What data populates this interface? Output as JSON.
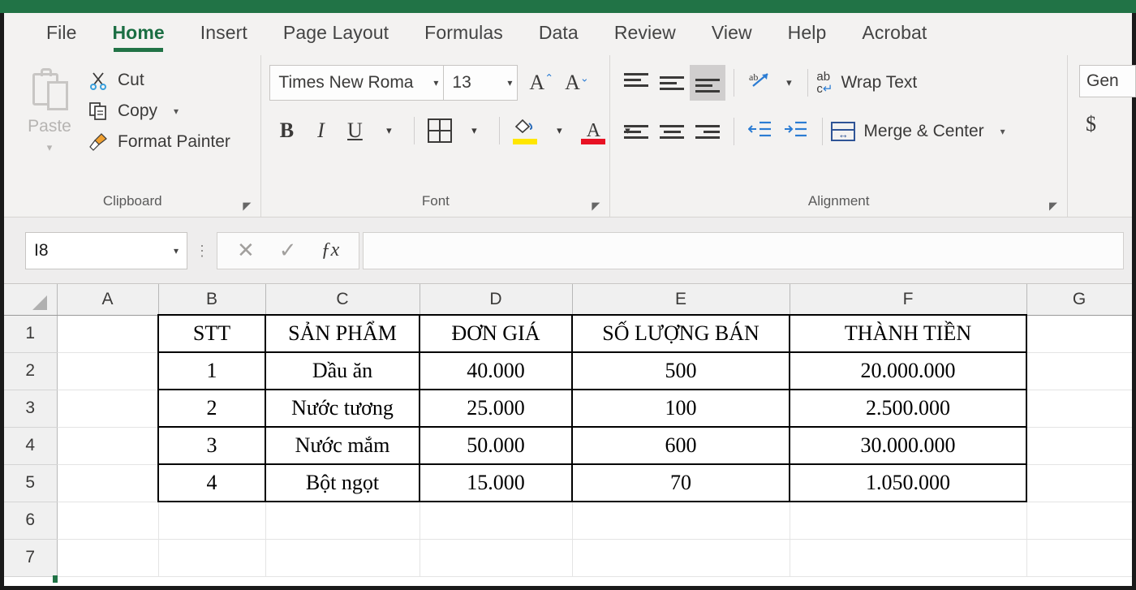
{
  "window": {
    "accent_color": "#217346"
  },
  "ribbon": {
    "tabs": [
      {
        "label": "File",
        "active": false
      },
      {
        "label": "Home",
        "active": true
      },
      {
        "label": "Insert",
        "active": false
      },
      {
        "label": "Page Layout",
        "active": false
      },
      {
        "label": "Formulas",
        "active": false
      },
      {
        "label": "Data",
        "active": false
      },
      {
        "label": "Review",
        "active": false
      },
      {
        "label": "View",
        "active": false
      },
      {
        "label": "Help",
        "active": false
      },
      {
        "label": "Acrobat",
        "active": false
      }
    ],
    "clipboard": {
      "group_label": "Clipboard",
      "paste_label": "Paste",
      "cut_label": "Cut",
      "copy_label": "Copy",
      "format_painter_label": "Format Painter",
      "paste_icon": "clipboard-icon",
      "cut_icon": "scissors-icon",
      "copy_icon": "copy-pages-icon",
      "format_painter_icon": "paintbrush-icon"
    },
    "font": {
      "group_label": "Font",
      "font_name": "Times New Roma",
      "font_size": "13",
      "grow_font": "A",
      "shrink_font": "A",
      "bold": "B",
      "italic": "I",
      "underline": "U",
      "borders_icon": "borders-grid-icon",
      "fill_color_icon": "fill-bucket-icon",
      "font_color_letter": "A",
      "fill_color": "#ffe600",
      "font_color": "#e81123"
    },
    "alignment": {
      "group_label": "Alignment",
      "top_align_icon": "align-top-icon",
      "middle_align_icon": "align-middle-icon",
      "bottom_align_icon": "align-bottom-icon",
      "bottom_align_selected": true,
      "orientation_icon": "text-orientation-icon",
      "align_left_icon": "align-left-icon",
      "align_center_icon": "align-center-icon",
      "align_right_icon": "align-right-icon",
      "decrease_indent_icon": "decrease-indent-icon",
      "increase_indent_icon": "increase-indent-icon",
      "wrap_text_label": "Wrap Text",
      "merge_center_label": "Merge & Center"
    },
    "number": {
      "format_value": "Gen",
      "currency_symbol": "$"
    }
  },
  "formula_bar": {
    "name_box_value": "I8",
    "cancel_icon": "close-x-icon",
    "enter_icon": "check-icon",
    "insert_function_icon": "fx-icon",
    "formula_value": ""
  },
  "sheet": {
    "columns": [
      "A",
      "B",
      "C",
      "D",
      "E",
      "F",
      "G"
    ],
    "rows": [
      "1",
      "2",
      "3",
      "4",
      "5",
      "6",
      "7"
    ],
    "selected_cell": "I8",
    "table": {
      "headers": [
        "STT",
        "SẢN PHẨM",
        "ĐƠN GIÁ",
        "SỐ LƯỢNG BÁN",
        "THÀNH TIỀN"
      ],
      "rows": [
        {
          "stt": "1",
          "san_pham": "Dầu ăn",
          "don_gia": "40.000",
          "so_luong": "500",
          "thanh_tien": "20.000.000"
        },
        {
          "stt": "2",
          "san_pham": "Nước tương",
          "don_gia": "25.000",
          "so_luong": "100",
          "thanh_tien": "2.500.000"
        },
        {
          "stt": "3",
          "san_pham": "Nước mắm",
          "don_gia": "50.000",
          "so_luong": "600",
          "thanh_tien": "30.000.000"
        },
        {
          "stt": "4",
          "san_pham": "Bột ngọt",
          "don_gia": "15.000",
          "so_luong": "70",
          "thanh_tien": "1.050.000"
        }
      ]
    }
  }
}
